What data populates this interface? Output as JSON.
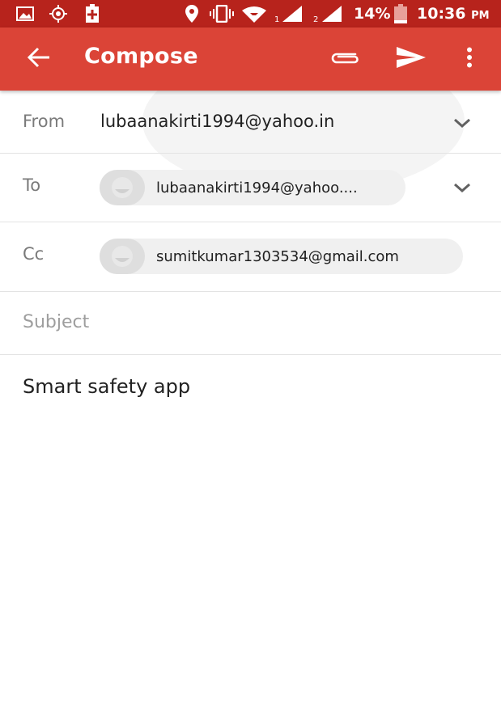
{
  "status_bar": {
    "battery": "14%",
    "time": "10:36",
    "ampm": "PM",
    "sim1": "1",
    "sim2": "2",
    "icons": [
      "gallery-icon",
      "location-target-icon",
      "battery-saver-icon",
      "location-pin-icon",
      "vibrate-icon",
      "wifi-icon",
      "signal-icon",
      "signal-icon",
      "battery-icon"
    ]
  },
  "app_bar": {
    "title": "Compose",
    "background": "#db4437",
    "actions": [
      "back-arrow-icon",
      "attach-icon",
      "send-icon",
      "more-vert-icon"
    ]
  },
  "compose": {
    "from": {
      "label": "From",
      "value": "lubaanakirti1994@yahoo.in"
    },
    "to": {
      "label": "To",
      "chip": "lubaanakirti1994@yahoo...."
    },
    "cc": {
      "label": "Cc",
      "chip": "sumitkumar1303534@gmail.com"
    },
    "subject": {
      "placeholder": "Subject"
    },
    "body": "Smart safety app"
  }
}
